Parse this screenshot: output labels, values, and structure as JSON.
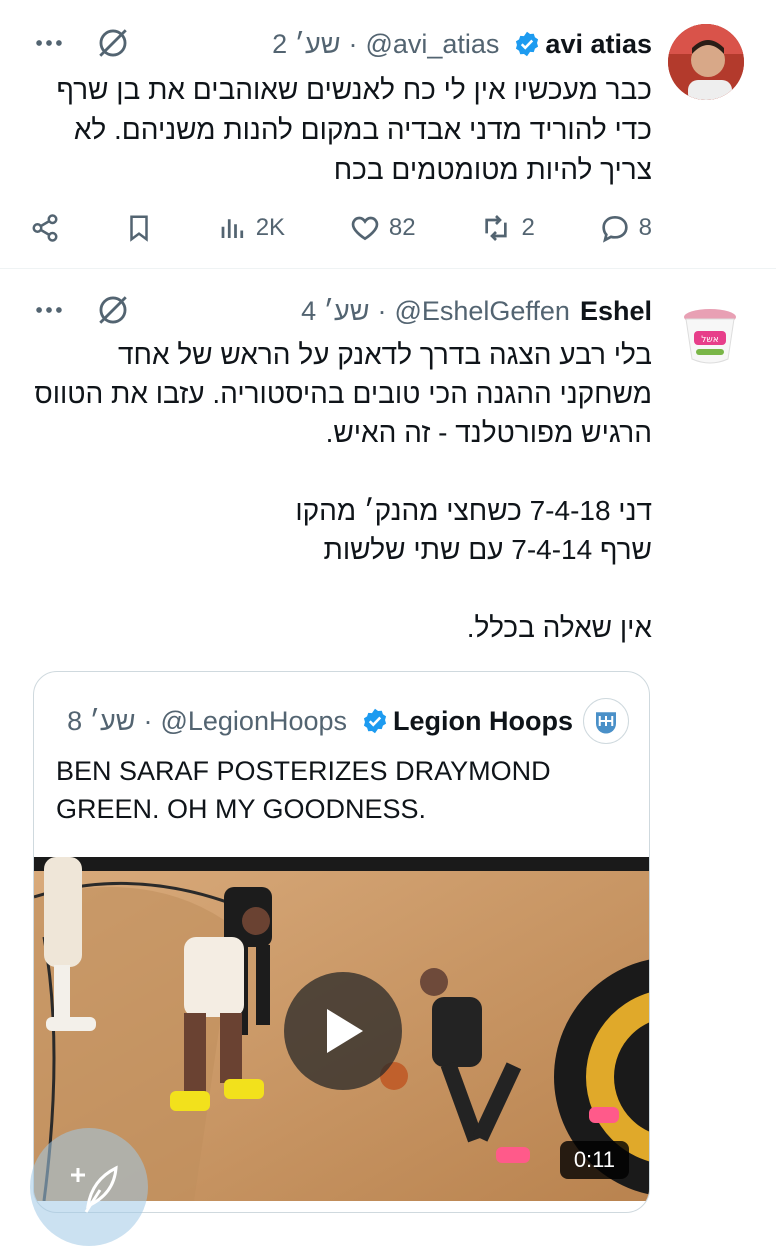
{
  "tweet1": {
    "display_name": "avi atias",
    "handle": "@avi_atias",
    "separator": "·",
    "time": "2 שע׳",
    "text_lines": [
      "כבר מעכשיו אין לי כח לאנשים שאוהבים את בן שרף",
      "כדי להוריד מדני אבדיה במקום להנות משניהם. לא",
      "צריך להיות מטומטמים בכח"
    ],
    "replies": "8",
    "retweets": "2",
    "likes": "82",
    "views": "2K"
  },
  "tweet2": {
    "display_name": "Eshel",
    "handle": "@EshelGeffen",
    "separator": "·",
    "time": "4 שע׳",
    "text_lines": [
      "בלי רבע הצגה בדרך לדאנק על הראש של אחד",
      "משחקני ההגנה הכי טובים בהיסטוריה. עזבו את הטווס",
      "הרגיש מפורטלנד - זה האיש.",
      "",
      "דני 7-4-18 כשחצי מהנק׳ מהקו",
      "שרף 7-4-14 עם שתי שלשות",
      "",
      "אין שאלה בכלל."
    ],
    "avatar_label": "אשל"
  },
  "quote": {
    "display_name": "Legion Hoops",
    "handle": "@LegionHoops",
    "separator": "·",
    "time": "8 שע׳",
    "text_lines": [
      "BEN SARAF POSTERIZES DRAYMOND",
      "GREEN. OH MY GOODNESS."
    ],
    "duration": "0:11"
  },
  "colors": {
    "verified": "#1d9bf0",
    "secondary": "#536471"
  }
}
